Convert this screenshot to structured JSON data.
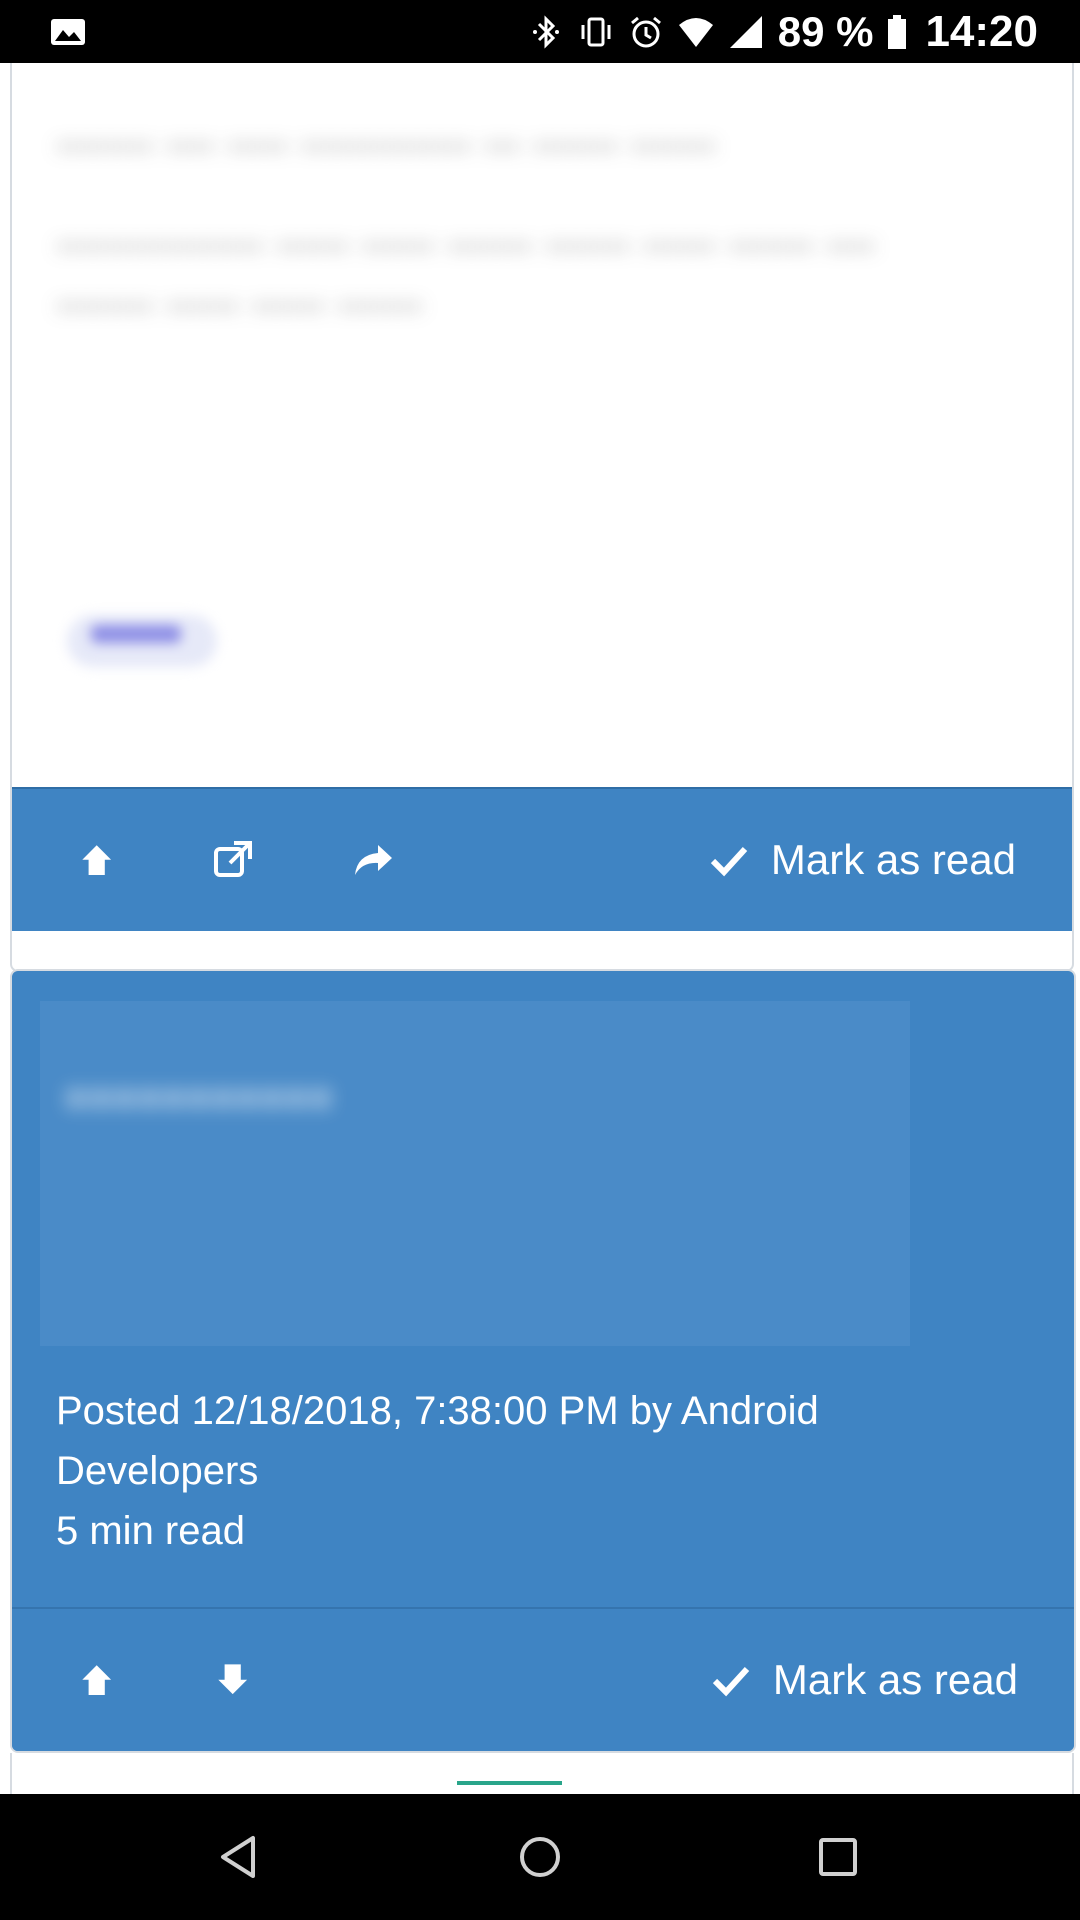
{
  "status_bar": {
    "battery_percent": "89 %",
    "time": "14:20",
    "icons": [
      "gallery-icon",
      "bluetooth-icon",
      "vibrate-icon",
      "alarm-icon",
      "wifi-icon",
      "cellular-signal-icon",
      "battery-icon"
    ]
  },
  "card1": {
    "blurred_body": [
      "........ .... ..... .............. ... ....... .......",
      "................. ...... ...... ....... ....... ...... ....... .... ........ ...... ...... ......."
    ],
    "actions": {
      "icons": [
        "arrow-up-icon",
        "external-link-icon",
        "share-icon"
      ],
      "mark_read_label": "Mark as read"
    }
  },
  "card2": {
    "blurred_title": "...........",
    "posted_line": "Posted 12/18/2018, 7:38:00 PM by Android",
    "posted_line_2": "Developers",
    "read_time": "5 min read",
    "accent_color": "#3f84c3",
    "actions": {
      "icons": [
        "arrow-up-icon",
        "arrow-down-icon"
      ],
      "mark_read_label": "Mark as read"
    }
  },
  "nav_bar": {
    "buttons": [
      "back-icon",
      "home-icon",
      "recents-icon"
    ]
  }
}
